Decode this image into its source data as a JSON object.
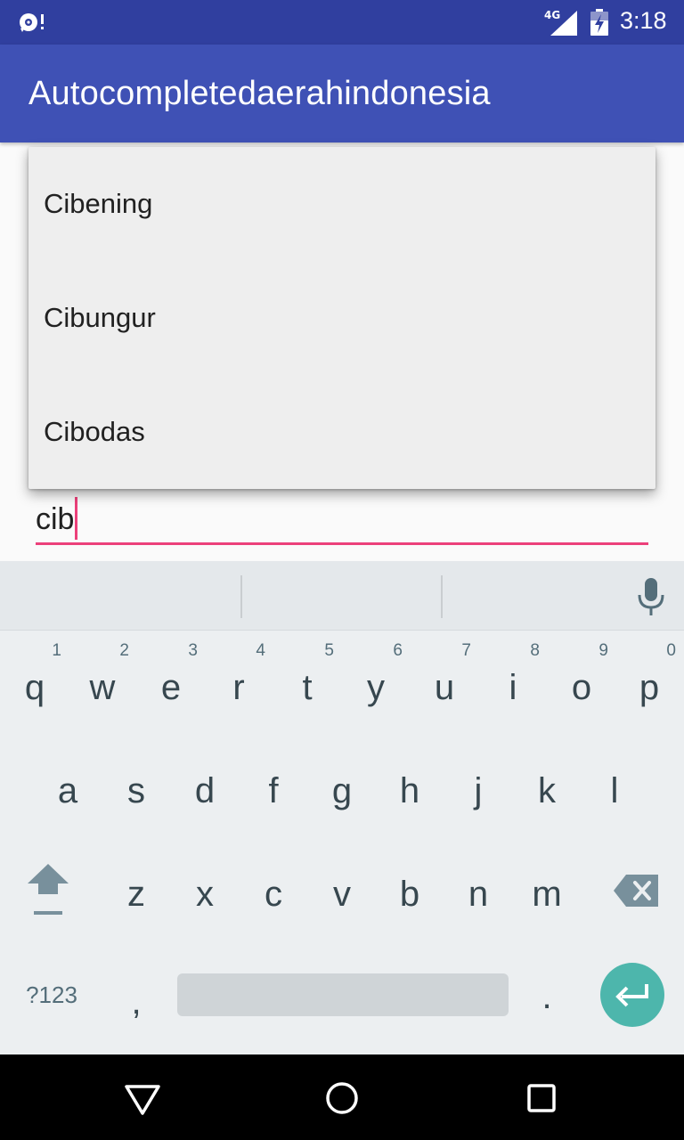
{
  "status_bar": {
    "network": "4G",
    "time": "3:18",
    "icons": [
      "sync-alert-icon",
      "signal-icon",
      "battery-charging-icon"
    ]
  },
  "app": {
    "title": "Autocompletedaerahindonesia"
  },
  "dropdown": {
    "items": [
      "Cibening",
      "Cibungur",
      "Cibodas"
    ]
  },
  "input": {
    "value": "cib"
  },
  "keyboard": {
    "row1": [
      {
        "key": "q",
        "hint": "1"
      },
      {
        "key": "w",
        "hint": "2"
      },
      {
        "key": "e",
        "hint": "3"
      },
      {
        "key": "r",
        "hint": "4"
      },
      {
        "key": "t",
        "hint": "5"
      },
      {
        "key": "y",
        "hint": "6"
      },
      {
        "key": "u",
        "hint": "7"
      },
      {
        "key": "i",
        "hint": "8"
      },
      {
        "key": "o",
        "hint": "9"
      },
      {
        "key": "p",
        "hint": "0"
      }
    ],
    "row2": [
      "a",
      "s",
      "d",
      "f",
      "g",
      "h",
      "j",
      "k",
      "l"
    ],
    "row3": [
      "z",
      "x",
      "c",
      "v",
      "b",
      "n",
      "m"
    ],
    "symbols_label": "?123",
    "comma": ",",
    "period": ".",
    "icons": [
      "microphone-icon",
      "shift-icon",
      "backspace-icon",
      "enter-icon"
    ]
  },
  "navigation": {
    "icons": [
      "back-icon",
      "home-icon",
      "recents-icon"
    ]
  },
  "colors": {
    "status_bar": "#303f9f",
    "toolbar": "#3f51b5",
    "accent": "#ec407a",
    "enter_key": "#4db6ac"
  }
}
